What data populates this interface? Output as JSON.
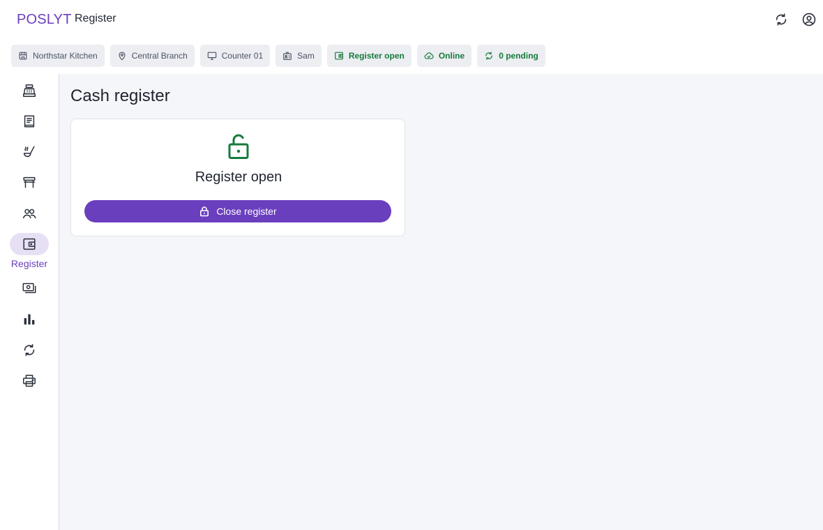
{
  "app": {
    "brand": "POSLYT",
    "page_label": "Register"
  },
  "header": {
    "icons": [
      "sync-icon",
      "account-circle-icon"
    ]
  },
  "chips": {
    "business": "Northstar Kitchen",
    "branch": "Central Branch",
    "counter": "Counter 01",
    "user": "Sam",
    "register_status": "Register open",
    "connection": "Online",
    "pending": "0 pending"
  },
  "sidebar": {
    "active_label": "Register",
    "items": [
      {
        "icon": "cash-register-icon"
      },
      {
        "icon": "orders-receipt-icon"
      },
      {
        "icon": "kitchen-icon"
      },
      {
        "icon": "tables-icon"
      },
      {
        "icon": "customers-icon"
      },
      {
        "icon": "wallet-register-icon",
        "label": "Register",
        "active": true
      },
      {
        "icon": "payments-icon"
      },
      {
        "icon": "reports-chart-icon"
      },
      {
        "icon": "sync-icon"
      },
      {
        "icon": "printer-icon"
      }
    ]
  },
  "main": {
    "title": "Cash register",
    "card": {
      "status": "Register open",
      "button_label": "Close register"
    }
  },
  "colors": {
    "accent": "#6a3fbd",
    "success": "#167a3c",
    "chip_bg": "#eceef2",
    "main_bg": "#f5f6f9"
  }
}
